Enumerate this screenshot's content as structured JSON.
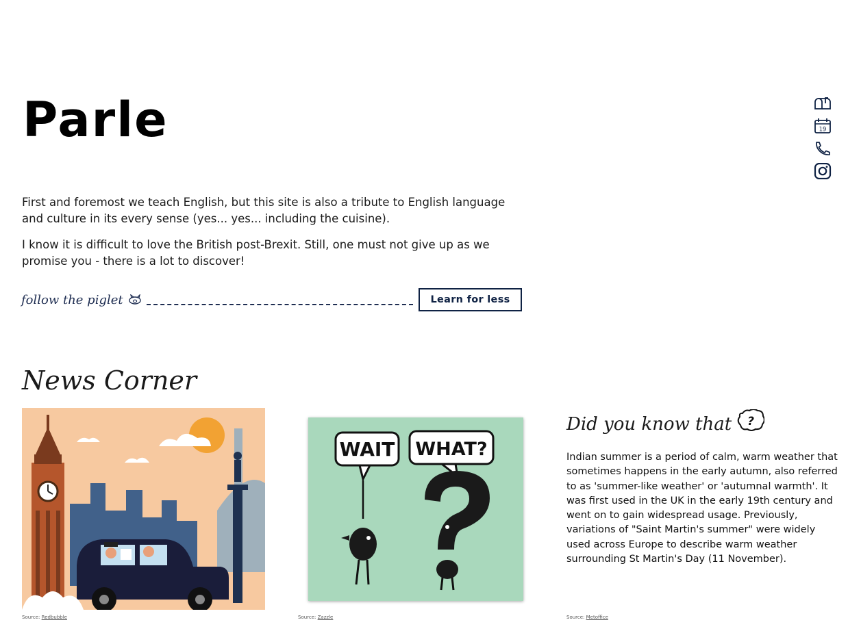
{
  "brand": {
    "name": "Parle"
  },
  "intro": {
    "paragraph_1": "First and foremost we teach English, but this site is also a tribute to English language and culture in its every sense (yes... yes... including the cuisine).",
    "paragraph_2": "I know it is difficult to love the British post-Brexit. Still, one must not give up as we promise you - there is a lot to discover!"
  },
  "piglet": {
    "label": "follow the piglet",
    "icon": "piglet-icon",
    "button_label": "Learn for less"
  },
  "side_icons": [
    {
      "name": "mailbox-icon"
    },
    {
      "name": "calendar-icon",
      "text": "19"
    },
    {
      "name": "phone-icon"
    },
    {
      "name": "instagram-icon"
    }
  ],
  "news": {
    "title": "News Corner",
    "cards": [
      {
        "image": "london-taxi-illustration",
        "source_prefix": "Source:",
        "source_link": "Redbubble"
      },
      {
        "image": "wait-what-cartoon",
        "bubble_1": "WAIT",
        "bubble_2": "WHAT?",
        "source_prefix": "Source:",
        "source_link": "Zazzle"
      },
      {
        "title": "Did you know that",
        "title_icon": "question-bubble-icon",
        "body": "Indian summer is a period of calm, warm weather that sometimes happens in the early autumn, also referred to as 'summer-like weather' or 'autumnal warmth'. It was first used in the UK in the early 19th century and went on to gain widespread usage. Previously, variations of \"Saint Martin's summer\" were widely used across Europe to describe warm weather surrounding St Martin's Day (11 November).",
        "source_prefix": "Source:",
        "source_link": "Metoffice"
      }
    ]
  },
  "colors": {
    "navy": "#0f2244",
    "mint": "#a9d8bc",
    "peach": "#f7c9a0"
  }
}
